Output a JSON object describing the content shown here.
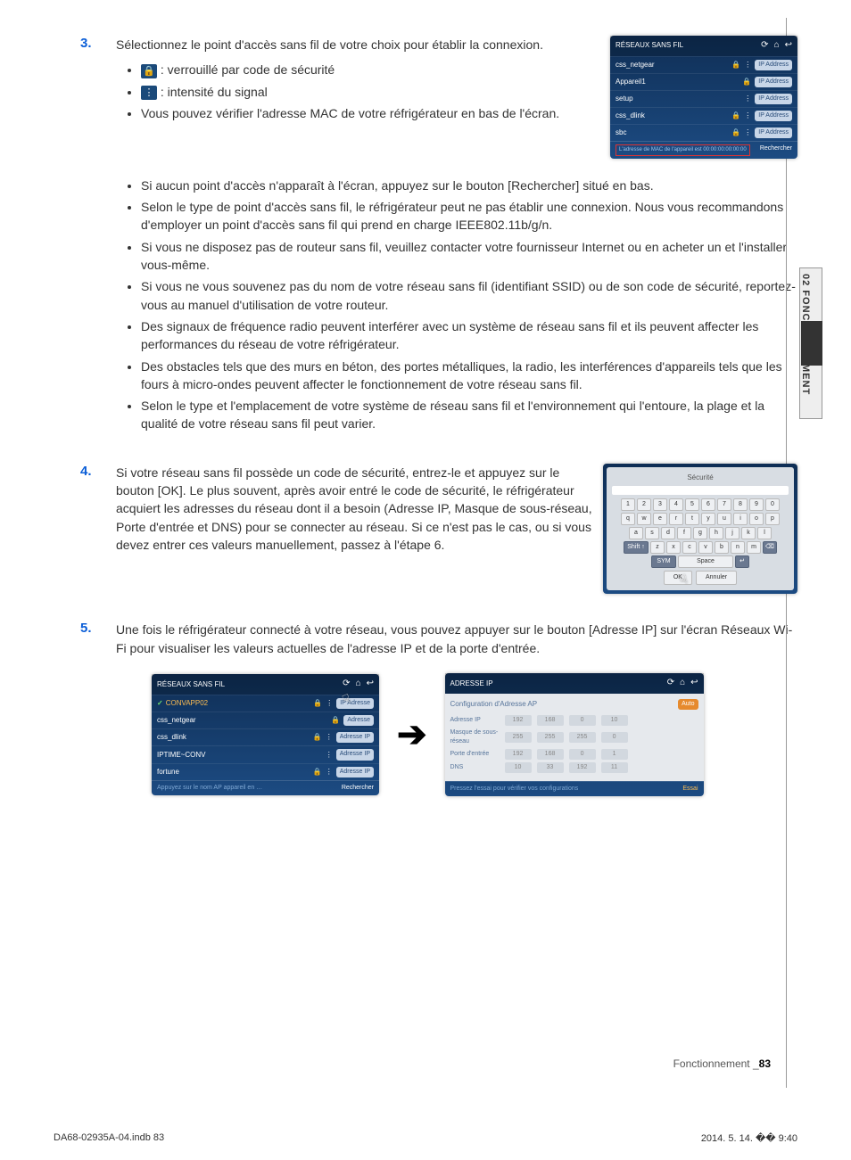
{
  "sideTab": "02  FONCTIONNEMENT",
  "step3": {
    "num": "3.",
    "text": "Sélectionnez le point d'accès sans fil de votre choix pour établir la connexion.",
    "iconBullets": {
      "lock": " : verrouillé par code de sécurité",
      "signal": " : intensité du signal",
      "mac": "Vous pouvez vérifier l'adresse MAC de votre réfrigérateur en bas de l'écran."
    },
    "notes": [
      "Si aucun point d'accès n'apparaît à l'écran, appuyez sur le bouton [Rechercher] situé en bas.",
      "Selon le type de point d'accès sans fil, le réfrigérateur peut ne pas établir une connexion. Nous vous recommandons d'employer un point d'accès sans fil qui prend en charge IEEE802.11b/g/n.",
      "Si vous ne disposez pas de routeur sans fil, veuillez contacter votre fournisseur Internet ou en acheter un et l'installer vous-même.",
      "Si vous ne vous souvenez pas du nom de votre réseau sans fil (identifiant SSID) ou de son code de sécurité, reportez-vous au manuel d'utilisation de votre routeur.",
      "Des signaux de fréquence radio peuvent interférer avec un système de réseau sans fil et ils peuvent affecter les performances du réseau de votre réfrigérateur.",
      "Des obstacles tels que des murs en béton, des portes métalliques, la radio, les interférences d'appareils tels que les fours à micro-ondes peuvent affecter le fonctionnement de votre réseau sans fil.",
      "Selon le type et l'emplacement de votre système de réseau sans fil et l'environnement qui l'entoure, la plage et la qualité de votre réseau sans fil peut varier."
    ]
  },
  "step4": {
    "num": "4.",
    "text": "Si votre réseau sans fil possède un code de sécurité, entrez-le et appuyez sur le bouton [OK]. Le plus souvent, après avoir entré le code de sécurité, le réfrigérateur acquiert les adresses du réseau dont il a besoin (Adresse IP, Masque de sous-réseau, Porte d'entrée et DNS) pour se connecter au réseau. Si ce n'est pas le cas, ou si vous devez entrer ces valeurs manuellement, passez à l'étape 6."
  },
  "step5": {
    "num": "5.",
    "text": "Une fois le réfrigérateur connecté à votre réseau, vous pouvez appuyer sur le bouton [Adresse IP] sur l'écran Réseaux Wi-Fi pour visualiser les valeurs actuelles de l'adresse IP et de la porte d'entrée."
  },
  "mock1": {
    "title": "RÉSEAUX SANS FIL",
    "rows": [
      {
        "name": "css_netgear",
        "lock": true,
        "wifi": true,
        "btn": "IP Address"
      },
      {
        "name": "Appareil1",
        "lock": true,
        "wifi": false,
        "btn": "IP Address"
      },
      {
        "name": "setup",
        "lock": false,
        "wifi": true,
        "btn": "IP Address"
      },
      {
        "name": "css_dlink",
        "lock": true,
        "wifi": true,
        "btn": "IP Address"
      },
      {
        "name": "sbc",
        "lock": true,
        "wifi": true,
        "btn": "IP Address"
      }
    ],
    "footerLeft": "L'adresse de MAC de l'appareil est 00:00:00:00:00:00",
    "footerRight": "Rechercher"
  },
  "mock_kb": {
    "title": "Sécurité",
    "row1": [
      "1",
      "2",
      "3",
      "4",
      "5",
      "6",
      "7",
      "8",
      "9",
      "0"
    ],
    "row2": [
      "q",
      "w",
      "e",
      "r",
      "t",
      "y",
      "u",
      "i",
      "o",
      "p"
    ],
    "row3": [
      "a",
      "s",
      "d",
      "f",
      "g",
      "h",
      "j",
      "k",
      "l"
    ],
    "row4_shift": "Shift ↑",
    "row4": [
      "z",
      "x",
      "c",
      "v",
      "b",
      "n",
      "m"
    ],
    "row4_bksp": "⌫",
    "sym": "SYM",
    "space": "Space",
    "enter": "↵",
    "ok": "OK",
    "cancel": "Annuler"
  },
  "mock_left": {
    "title": "RÉSEAUX SANS FIL",
    "rows": [
      {
        "check": true,
        "name": "CONVAPP02",
        "lock": true,
        "wifi": true,
        "btn": "IP Adresse"
      },
      {
        "check": false,
        "name": "css_netgear",
        "lock": true,
        "wifi": false,
        "btn": "Adresse"
      },
      {
        "check": false,
        "name": "css_dlink",
        "lock": true,
        "wifi": true,
        "btn": "Adresse IP"
      },
      {
        "check": false,
        "name": "IPTIME~CONV",
        "lock": false,
        "wifi": true,
        "btn": "Adresse IP"
      },
      {
        "check": false,
        "name": "fortune",
        "lock": true,
        "wifi": true,
        "btn": "Adresse IP"
      }
    ],
    "footerLeft": "Appuyez sur le nom AP appareil en …",
    "footerRight": "Rechercher"
  },
  "mock_right": {
    "title": "ADRESSE IP",
    "config": "Configuration d'Adresse AP",
    "auto": "Auto",
    "rows": [
      {
        "lbl": "Adresse IP",
        "v": [
          "192",
          "168",
          "0",
          "10"
        ]
      },
      {
        "lbl": "Masque de sous-réseau",
        "v": [
          "255",
          "255",
          "255",
          "0"
        ]
      },
      {
        "lbl": "Porte d'entrée",
        "v": [
          "192",
          "168",
          "0",
          "1"
        ]
      },
      {
        "lbl": "DNS",
        "v": [
          "10",
          "33",
          "192",
          "11"
        ]
      }
    ],
    "footerLeft": "Pressez l'essai pour vérifier vos configurations",
    "footerRight": "Essai"
  },
  "footer": {
    "section": "Fonctionnement _",
    "page": "83",
    "printLeft": "DA68-02935A-04.indb   83",
    "printRight": "2014. 5. 14.   �� 9:40"
  }
}
